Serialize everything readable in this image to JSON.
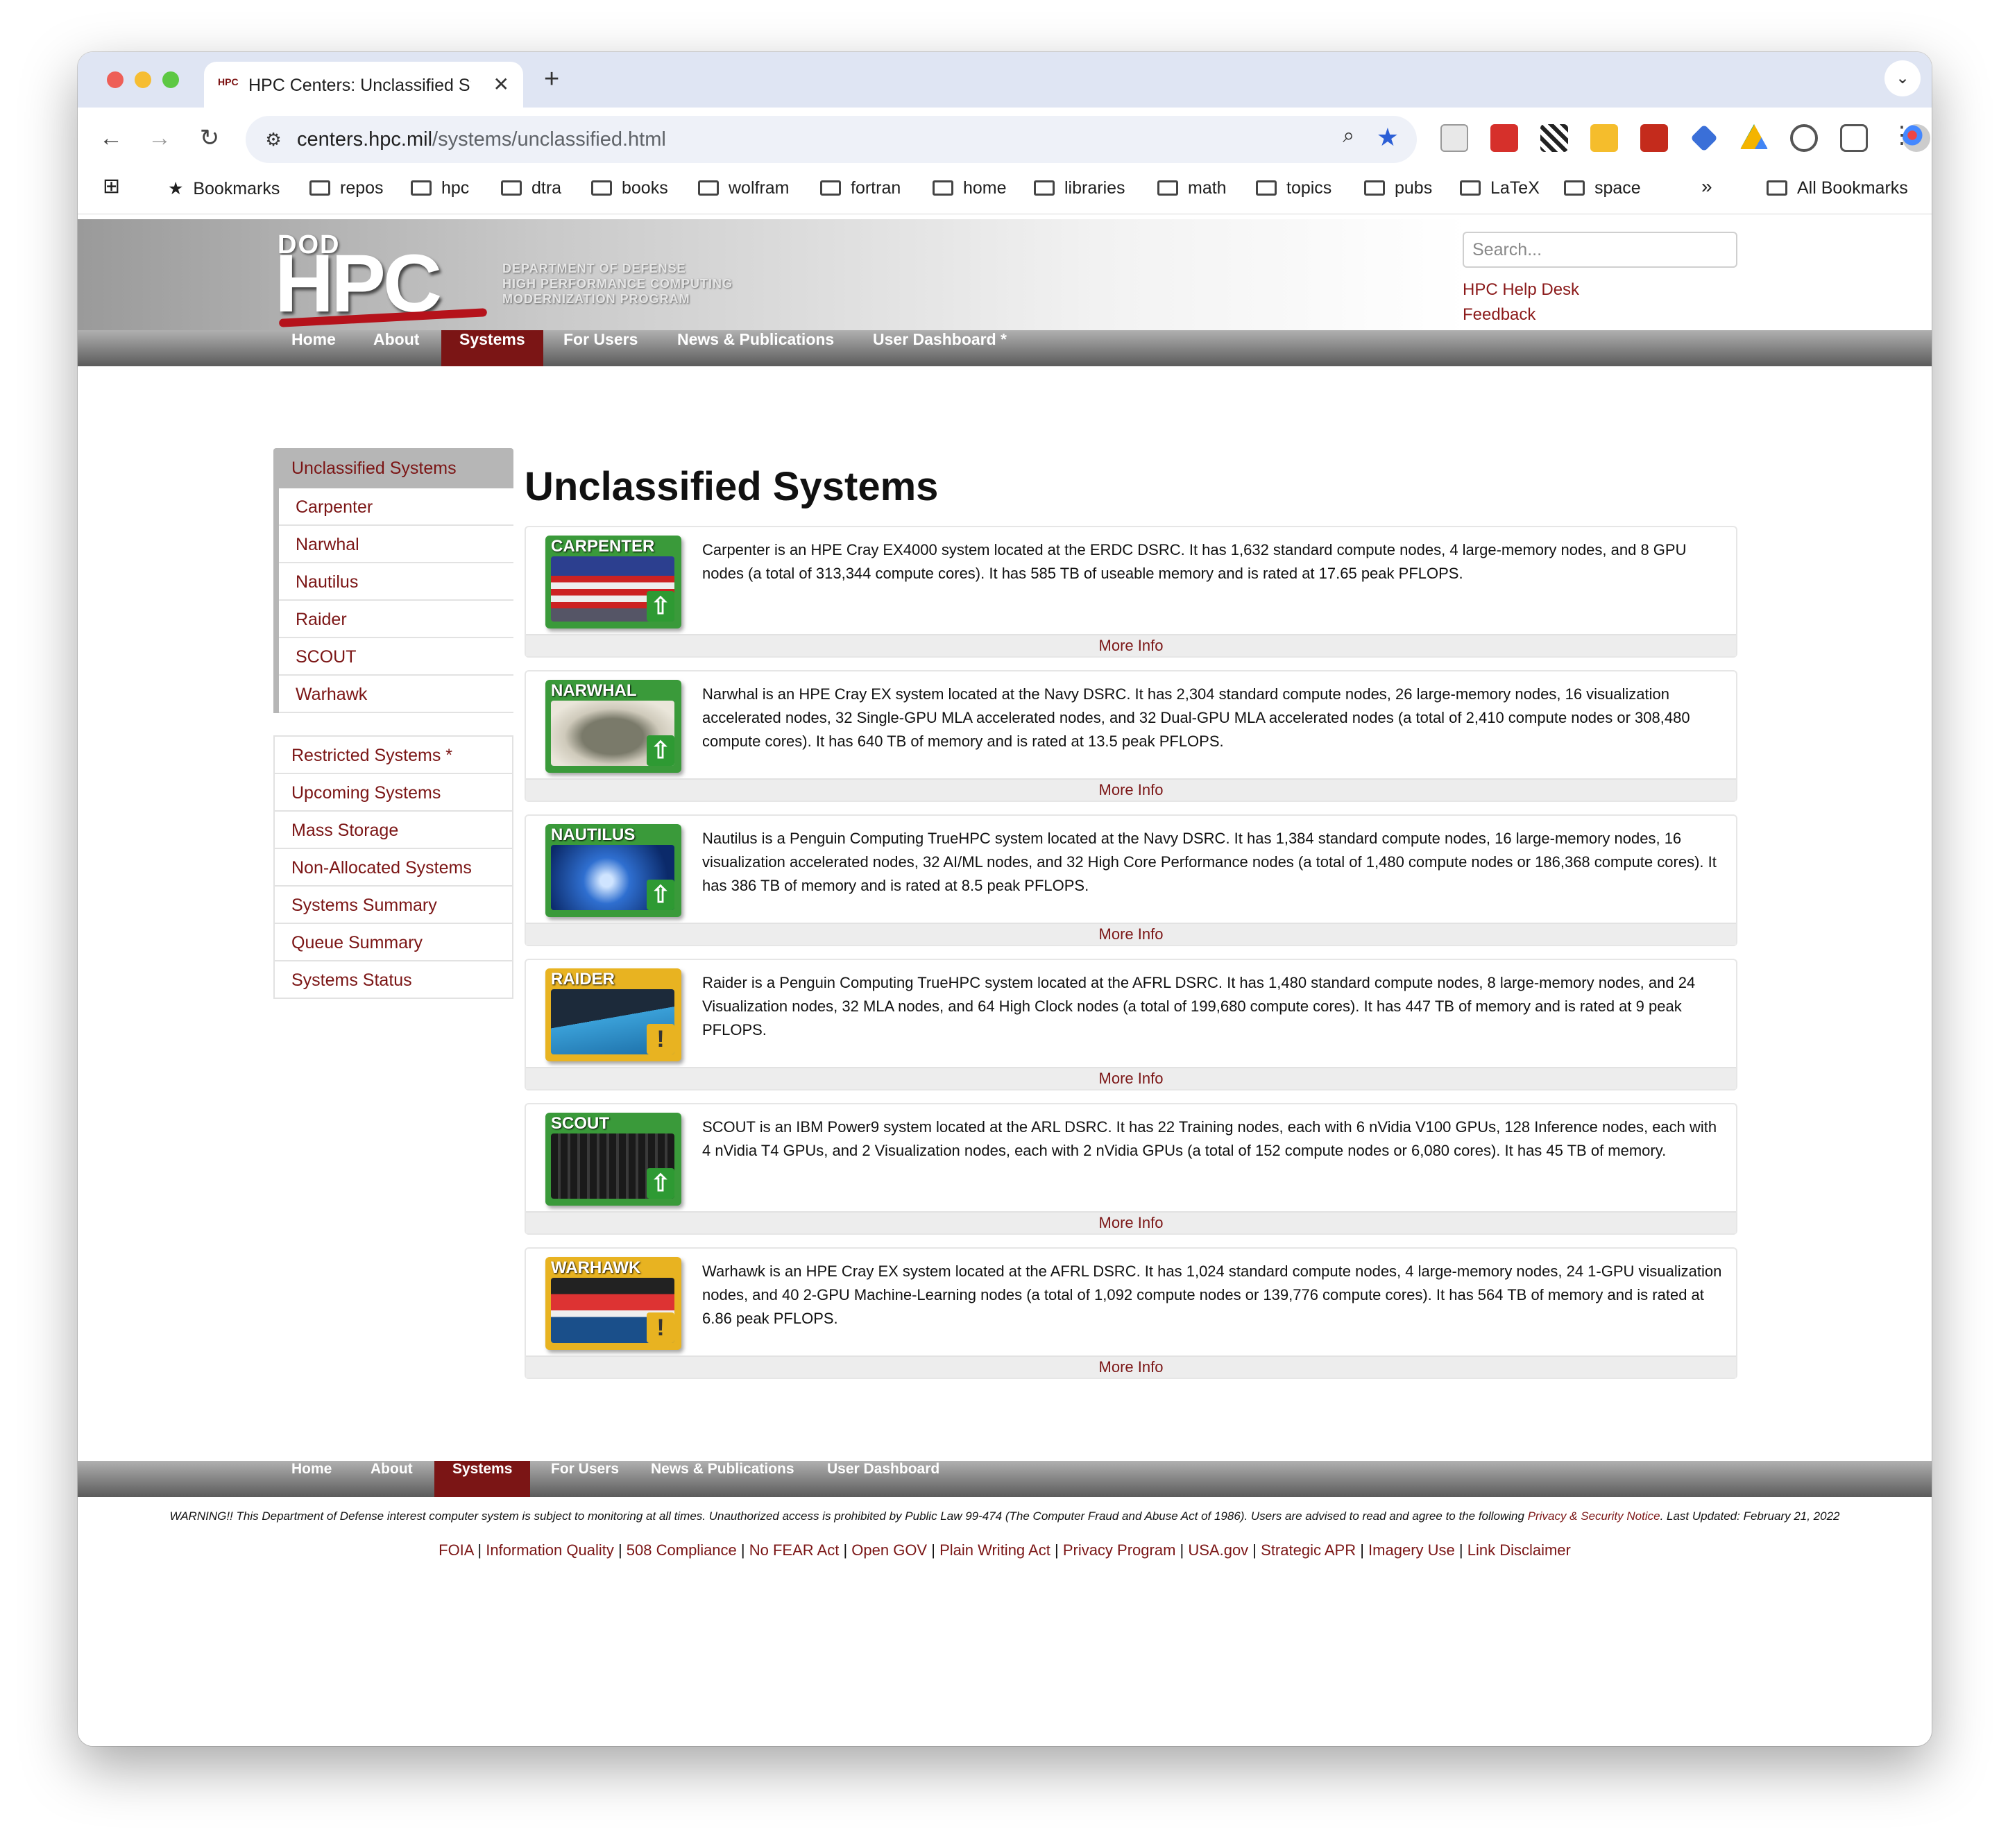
{
  "browser": {
    "tab_title": "HPC Centers: Unclassified Sy",
    "tab_favicon": "HPC",
    "url_host": "centers.hpc.mil",
    "url_path": "/systems/unclassified.html",
    "bookmarks": [
      "Bookmarks",
      "repos",
      "hpc",
      "dtra",
      "books",
      "wolfram",
      "fortran",
      "home",
      "libraries",
      "math",
      "topics",
      "pubs",
      "LaTeX",
      "space"
    ],
    "all_bookmarks": "All Bookmarks"
  },
  "header": {
    "logo_dod": "DOD",
    "logo_hpc": "HPC",
    "logo_line1": "DEPARTMENT OF DEFENSE",
    "logo_line2": "HIGH PERFORMANCE COMPUTING",
    "logo_line3": "MODERNIZATION PROGRAM",
    "search_placeholder": "Search...",
    "help_desk": "HPC Help Desk",
    "feedback": "Feedback"
  },
  "nav": {
    "home": "Home",
    "about": "About",
    "systems": "Systems",
    "for_users": "For Users",
    "news": "News & Publications",
    "dashboard": "User Dashboard *"
  },
  "sidebar": {
    "heading": "Unclassified Systems",
    "systems": [
      "Carpenter",
      "Narwhal",
      "Nautilus",
      "Raider",
      "SCOUT",
      "Warhawk"
    ],
    "other": [
      "Restricted Systems *",
      "Upcoming Systems",
      "Mass Storage",
      "Non-Allocated Systems",
      "Systems Summary",
      "Queue Summary",
      "Systems Status"
    ]
  },
  "main": {
    "title": "Unclassified Systems",
    "more_info": "More Info",
    "cards": [
      {
        "label": "CARPENTER",
        "status": "up",
        "desc": "Carpenter is an HPE Cray EX4000 system located at the ERDC DSRC. It has 1,632 standard compute nodes, 4 large-memory nodes, and 8 GPU nodes (a total of 313,344 compute cores). It has 585 TB of useable memory and is rated at 17.65 peak PFLOPS."
      },
      {
        "label": "NARWHAL",
        "status": "up",
        "desc": "Narwhal is an HPE Cray EX system located at the Navy DSRC. It has 2,304 standard compute nodes, 26 large-memory nodes, 16 visualization accelerated nodes, 32 Single-GPU MLA accelerated nodes, and 32 Dual-GPU MLA accelerated nodes (a total of 2,410 compute nodes or 308,480 compute cores). It has 640 TB of memory and is rated at 13.5 peak PFLOPS."
      },
      {
        "label": "NAUTILUS",
        "status": "up",
        "desc": "Nautilus is a Penguin Computing TrueHPC system located at the Navy DSRC. It has 1,384 standard compute nodes, 16 large-memory nodes, 16 visualization accelerated nodes, 32 AI/ML nodes, and 32 High Core Performance nodes (a total of 1,480 compute nodes or 186,368 compute cores). It has 386 TB of memory and is rated at 8.5 peak PFLOPS."
      },
      {
        "label": "RAIDER",
        "status": "warning",
        "desc": "Raider is a Penguin Computing TrueHPC system located at the AFRL DSRC. It has 1,480 standard compute nodes, 8 large-memory nodes, and 24 Visualization nodes, 32 MLA nodes, and 64 High Clock nodes (a total of 199,680 compute cores). It has 447 TB of memory and is rated at 9 peak PFLOPS."
      },
      {
        "label": "SCOUT",
        "status": "up",
        "desc": "SCOUT is an IBM Power9 system located at the ARL DSRC. It has 22 Training nodes, each with 6 nVidia V100 GPUs, 128 Inference nodes, each with 4 nVidia T4 GPUs, and 2 Visualization nodes, each with 2 nVidia GPUs (a total of 152 compute nodes or 6,080 cores). It has 45 TB of memory."
      },
      {
        "label": "WARHAWK",
        "status": "warning",
        "desc": "Warhawk is an HPE Cray EX system located at the AFRL DSRC. It has 1,024 standard compute nodes, 4 large-memory nodes, 24 1-GPU visualization nodes, and 40 2-GPU Machine-Learning nodes (a total of 1,092 compute nodes or 139,776 compute cores). It has 564 TB of memory and is rated at 6.86 peak PFLOPS."
      }
    ]
  },
  "footer": {
    "nav": [
      "Home",
      "About",
      "Systems",
      "For Users",
      "News & Publications",
      "User Dashboard"
    ],
    "warning_text": "WARNING!! This Department of Defense interest computer system is subject to monitoring at all times. Unauthorized access is prohibited by Public Law 99-474 (The Computer Fraud and Abuse Act of 1986). Users are advised to read and agree to the following",
    "warning_link": "Privacy & Security Notice",
    "updated": ". Last Updated: February 21, 2022",
    "links": [
      "FOIA",
      "Information Quality",
      "508 Compliance",
      "No FEAR Act",
      "Open GOV",
      "Plain Writing Act",
      "Privacy Program",
      "USA.gov",
      "Strategic APR",
      "Imagery Use",
      "Link Disclaimer"
    ]
  },
  "colors": {
    "brand_maroon": "#7b1515",
    "status_up": "#2e9a33",
    "status_warning": "#e8b321"
  }
}
